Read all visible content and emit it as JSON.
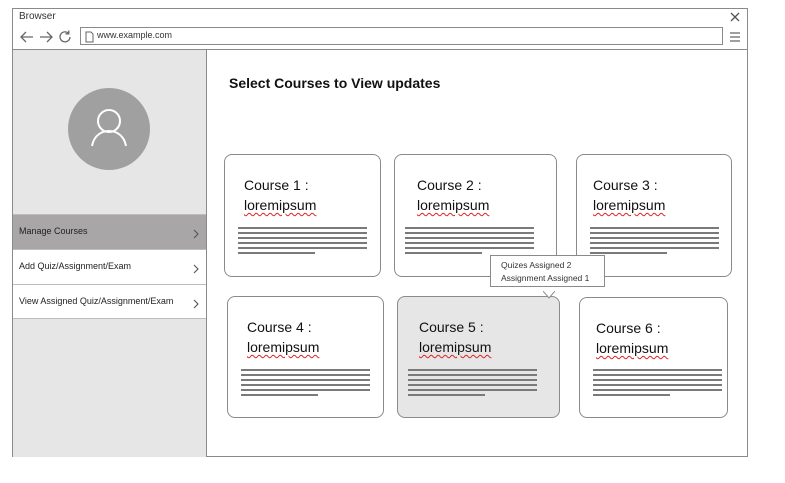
{
  "window": {
    "title": "Browser",
    "url": "www.example.com"
  },
  "sidebar": {
    "items": [
      {
        "label": "Manage Courses",
        "active": true
      },
      {
        "label": "Add Quiz/Assignment/Exam",
        "active": false
      },
      {
        "label": "View Assigned Quiz/Assignment/Exam",
        "active": false
      }
    ]
  },
  "main": {
    "title": "Select Courses to View updates",
    "courses": [
      {
        "line1": "Course 1 :",
        "line2": "loremipsum"
      },
      {
        "line1": "Course 2 :",
        "line2": "loremipsum"
      },
      {
        "line1": "Course 3 :",
        "line2": "loremipsum"
      },
      {
        "line1": "Course 4 :",
        "line2": "loremipsum"
      },
      {
        "line1": "Course 5 :",
        "line2": "loremipsum"
      },
      {
        "line1": "Course 6 :",
        "line2": "loremipsum"
      }
    ],
    "tooltip": {
      "line1": "Quizes Assigned 2",
      "line2": "Assignment Assigned 1"
    }
  },
  "icons": {
    "back": "arrow-left-icon",
    "forward": "arrow-right-icon",
    "reload": "reload-icon",
    "page": "page-icon",
    "menu": "hamburger-menu-icon",
    "close": "close-icon",
    "avatar": "user-avatar-icon",
    "chevron": "chevron-right-icon"
  },
  "colors": {
    "sidebar_bg": "#e6e6e6",
    "active_item": "#a8a6a6",
    "avatar": "#a0a0a0",
    "hover_card": "#e6e6e6"
  }
}
